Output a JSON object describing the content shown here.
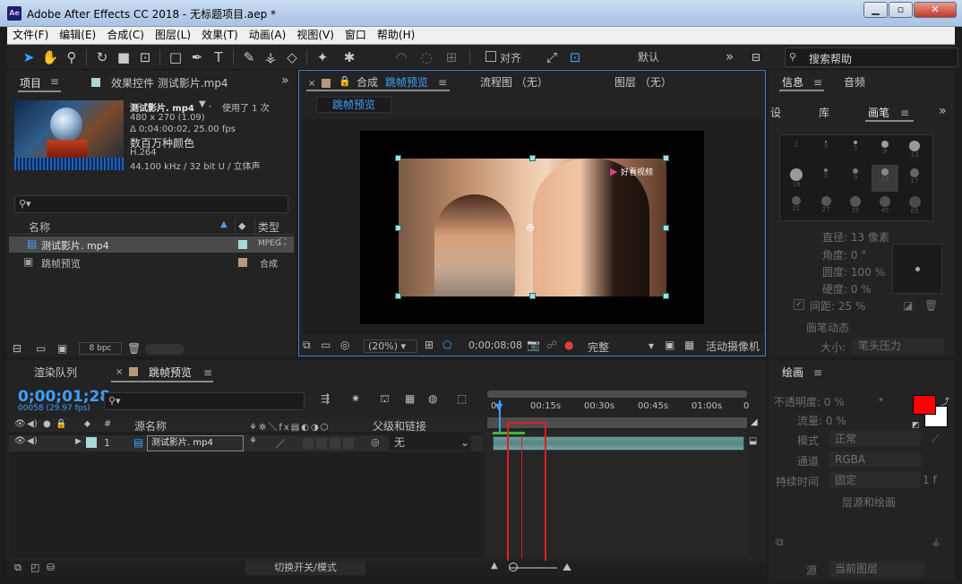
{
  "window": {
    "app_icon": "Ae",
    "title": "Adobe After Effects CC 2018 - 无标题项目.aep *"
  },
  "menu": [
    "文件(F)",
    "编辑(E)",
    "合成(C)",
    "图层(L)",
    "效果(T)",
    "动画(A)",
    "视图(V)",
    "窗口",
    "帮助(H)"
  ],
  "toolbar": {
    "snap_label": "对齐",
    "workspace": "默认",
    "search_placeholder": "搜索帮助",
    "expand": "»"
  },
  "project": {
    "tab_project": "项目",
    "tab_effects": "效果控件 测试影片.mp4",
    "footage_name": "测试影片. mp4",
    "used": "使用了 1 次",
    "dims": "480 x 270 (1.09)",
    "duration": "Δ 0;04:00:02, 25.00 fps",
    "colors": "数百万种颜色",
    "codec": "H.264",
    "audio": "44.100 kHz / 32 bit U / 立体声",
    "col_name": "名称",
    "col_type": "类型",
    "items": [
      {
        "name": "测试影片. mp4",
        "type": "MPEG",
        "color": "#a8d8d8"
      },
      {
        "name": "跳帧预览",
        "type": "合成",
        "color": "#b59a7a"
      }
    ],
    "bpc": "8 bpc"
  },
  "viewer": {
    "tab_prefix": "合成",
    "tab_name": "跳帧预览",
    "tab_flow": "流程图 （无）",
    "tab_layer": "图层 （无）",
    "subtab": "跳帧预览",
    "zoom": "(20%)",
    "timecode": "0;00;08;08",
    "quality": "完整",
    "camera": "活动摄像机",
    "watermark": "好看视频"
  },
  "right": {
    "tab_info": "信息",
    "tab_audio": "音频",
    "tab_settings": "设",
    "tab_library": "库",
    "tab_brush": "画笔",
    "brush_sizes": [
      "1",
      "3",
      "5",
      "9",
      "13",
      "19",
      "5",
      "9",
      "13",
      "17",
      "21",
      "27",
      "35",
      "45",
      "65"
    ],
    "diameter": "直径: 13 像素",
    "angle": "角度: 0 °",
    "roundness": "圆度: 100 %",
    "hardness": "硬度: 0 %",
    "spacing": "间距: 25 %",
    "brush_dynamics": "画笔动态",
    "size_label": "大小:",
    "size_value": "笔头压力"
  },
  "timeline": {
    "tab_render": "渲染队列",
    "tab_comp": "跳帧预览",
    "timecode": "0;00;01;28",
    "frame_info": "00058 (29.97 fps)",
    "col_source": "源名称",
    "col_parent": "父级和链接",
    "layer_number": "1",
    "layer_name": "测试影片. mp4",
    "parent_value": "无",
    "ruler_ticks": [
      "0s",
      "00:15s",
      "00:30s",
      "00:45s",
      "01:00s",
      "0"
    ],
    "switch_mode": "切换开关/模式"
  },
  "paint": {
    "title": "绘画",
    "opacity": "不透明度: 0 %",
    "flow": "流量: 0 %",
    "mode_label": "模式",
    "mode_value": "正常",
    "channel_label": "通道",
    "channel_value": "RGBA",
    "duration_label": "持续时间",
    "duration_value": "固定",
    "duration_frames": "1 f",
    "clone_label": "源",
    "clone_value": "当前图层",
    "layer_source": "层源和绘画"
  },
  "colors": {
    "accent": "#3ea0ff",
    "foreground_swatch": "#ff0000",
    "background_swatch": "#ffffff",
    "highlight_box": "#e02020"
  }
}
